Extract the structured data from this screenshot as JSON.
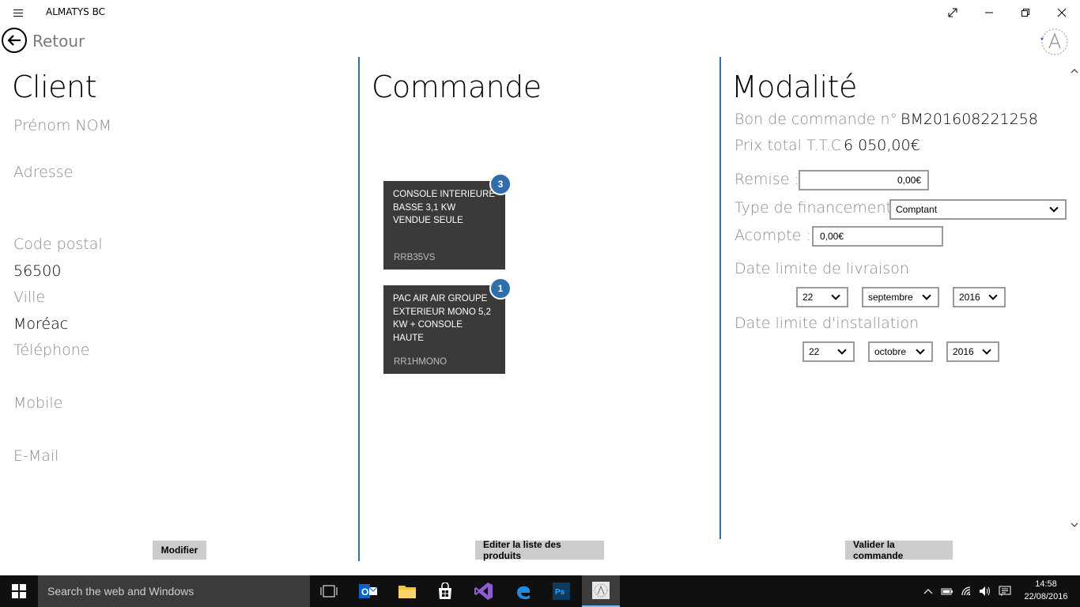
{
  "window": {
    "title": "ALMATYS BC"
  },
  "nav": {
    "back_label": "Retour"
  },
  "client": {
    "title": "Client",
    "name_label": "Prénom NOM",
    "address_label": "Adresse",
    "postal_label": "Code postal",
    "postal_value": "56500",
    "city_label": "Ville",
    "city_value": "Moréac",
    "phone_label": "Téléphone",
    "mobile_label": "Mobile",
    "email_label": "E-Mail",
    "modify_button": "Modifier"
  },
  "order": {
    "title": "Commande",
    "products": [
      {
        "name": "CONSOLE INTERIEURE BASSE 3,1 KW VENDUE SEULE",
        "code": "RRB35VS",
        "quantity": "3"
      },
      {
        "name": "PAC AIR AIR GROUPE EXTERIEUR MONO 5,2 KW + CONSOLE HAUTE",
        "code": "RR1HMONO",
        "quantity": "1"
      }
    ],
    "edit_button": "Editer la liste des produits"
  },
  "terms": {
    "title": "Modalité",
    "order_number_label": "Bon de commande n° :",
    "order_number_value": "BM201608221258",
    "total_label": "Prix total T.T.C :",
    "total_value": "6 050,00€",
    "discount_label": "Remise :",
    "discount_value": "0,00€",
    "financing_label": "Type de financement :",
    "financing_value": "Comptant",
    "deposit_label": "Acompte :",
    "deposit_value": "0,00€",
    "delivery_label": "Date limite de livraison",
    "delivery_day": "22",
    "delivery_month": "septembre",
    "delivery_year": "2016",
    "install_label": "Date limite d'installation",
    "install_day": "22",
    "install_month": "octobre",
    "install_year": "2016",
    "validate_button": "Valider la commande"
  },
  "taskbar": {
    "search_placeholder": "Search the web and Windows",
    "time": "14:58",
    "date": "22/08/2016"
  },
  "colors": {
    "accent": "#2d6fa8",
    "tile": "#3a3a3a",
    "button": "#cccccc",
    "taskbar": "#101010"
  }
}
